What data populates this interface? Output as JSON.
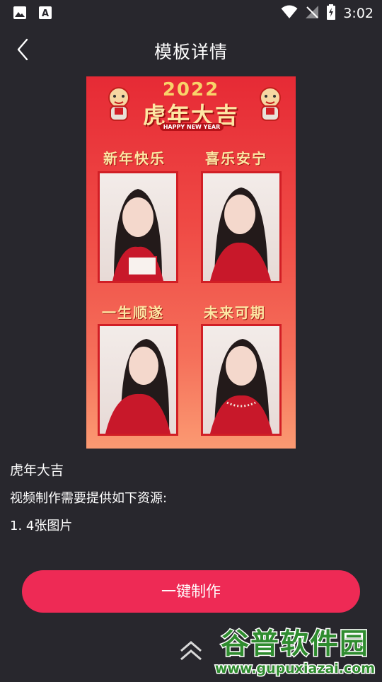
{
  "status_bar": {
    "time": "3:02",
    "icons": [
      "image-icon",
      "font-download-icon",
      "wifi-icon",
      "signal-off-icon",
      "battery-charging-icon"
    ]
  },
  "header": {
    "title": "模板详情",
    "back_icon": "chevron-left-icon"
  },
  "preview": {
    "year_text": "2022",
    "banner_title": "虎年大吉",
    "banner_subtitle": "HAPPY NEW YEAR",
    "captions": [
      "新年快乐",
      "喜乐安宁",
      "一生顺遂",
      "未来可期"
    ]
  },
  "description": {
    "title": "虎年大吉",
    "requirement": "视频制作需要提供如下资源:",
    "item1": "1. 4张图片"
  },
  "action": {
    "make_label": "一键制作",
    "scroll_icon": "double-chevron-up-icon"
  },
  "watermark": {
    "name": "谷普软件园",
    "url": "www.gupuxiazai.com"
  },
  "colors": {
    "background": "#28272d",
    "accent": "#ee2a55",
    "template_red": "#e62a35",
    "gold": "#fde7a4"
  }
}
